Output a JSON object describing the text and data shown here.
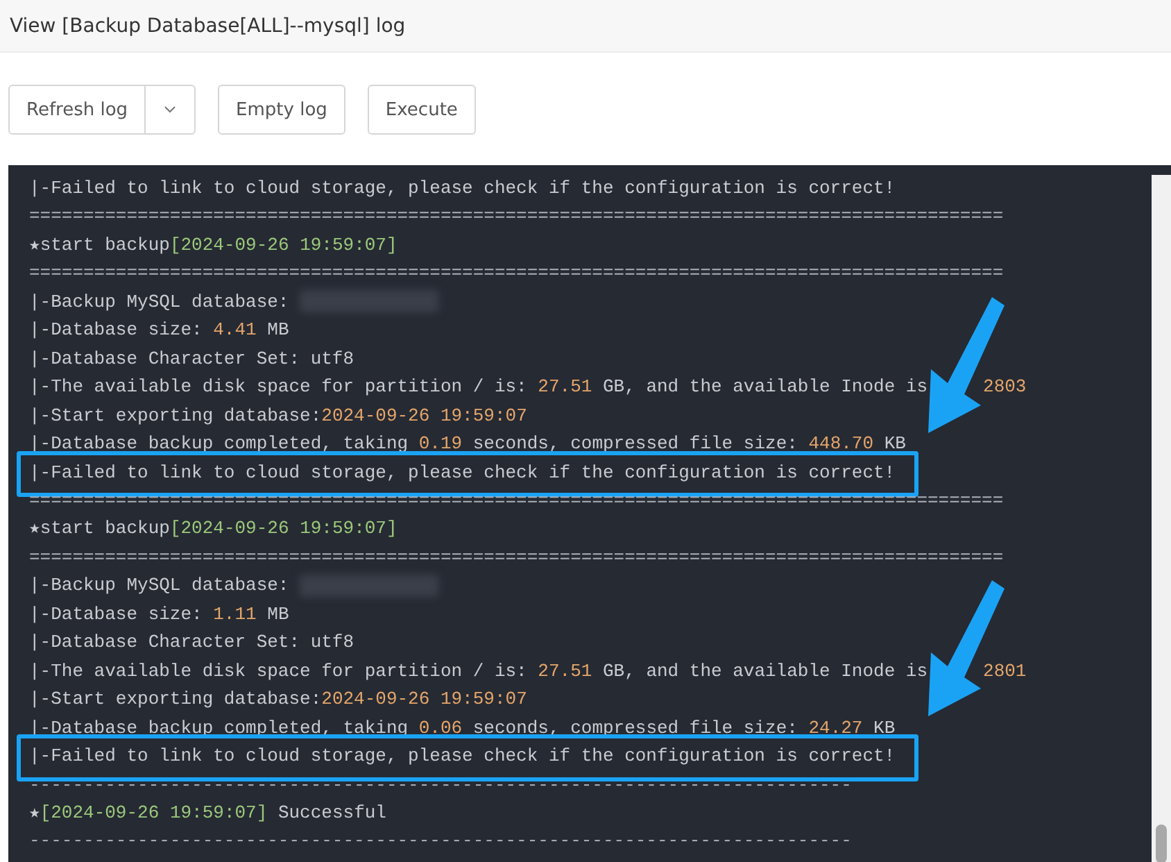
{
  "window": {
    "title": "View [Backup Database[ALL]--mysql] log"
  },
  "buttons": [
    {
      "kind": "split",
      "label": "Refresh log"
    },
    {
      "kind": "plain",
      "label": "Empty log"
    },
    {
      "kind": "plain",
      "label": "Execute"
    }
  ],
  "log": [
    {
      "highlighted": false,
      "segments": [
        {
          "kind": "plain",
          "text": "|-Failed to link to cloud storage, please check if the configuration is correct!"
        }
      ]
    },
    {
      "highlighted": false,
      "segments": [
        {
          "kind": "rule",
          "text": "=========================================================================================="
        }
      ]
    },
    {
      "highlighted": false,
      "segments": [
        {
          "kind": "plain",
          "text": "★start backup"
        },
        {
          "kind": "green",
          "text": "[2024-09-26 19:59:07]"
        }
      ]
    },
    {
      "highlighted": false,
      "segments": [
        {
          "kind": "rule",
          "text": "=========================================================================================="
        }
      ]
    },
    {
      "highlighted": false,
      "segments": [
        {
          "kind": "plain",
          "text": "|-Backup MySQL database: "
        },
        {
          "kind": "redacted"
        }
      ]
    },
    {
      "highlighted": false,
      "segments": [
        {
          "kind": "plain",
          "text": "|-Database size: "
        },
        {
          "kind": "orange",
          "text": "4.41"
        },
        {
          "kind": "plain",
          "text": " MB"
        }
      ]
    },
    {
      "highlighted": false,
      "segments": [
        {
          "kind": "plain",
          "text": "|-Database Character Set: utf8"
        }
      ]
    },
    {
      "highlighted": false,
      "segments": [
        {
          "kind": "plain",
          "text": "|-The available disk space for partition / is: "
        },
        {
          "kind": "orange",
          "text": "27.51"
        },
        {
          "kind": "plain",
          "text": " GB, and the available Inode is"
        },
        {
          "kind": "gap"
        },
        {
          "kind": "orange",
          "text": "2803"
        }
      ]
    },
    {
      "highlighted": false,
      "segments": [
        {
          "kind": "plain",
          "text": "|-Start exporting database:"
        },
        {
          "kind": "orange",
          "text": "2024-09-26 19:59:07"
        }
      ]
    },
    {
      "highlighted": false,
      "segments": [
        {
          "kind": "plain",
          "text": "|-Database backup completed, taking "
        },
        {
          "kind": "orange",
          "text": "0.19"
        },
        {
          "kind": "plain",
          "text": " seconds, compressed file size: "
        },
        {
          "kind": "orange",
          "text": "448.70"
        },
        {
          "kind": "plain",
          "text": " KB"
        }
      ]
    },
    {
      "highlighted": true,
      "segments": [
        {
          "kind": "plain",
          "text": "|-Failed to link to cloud storage, please check if the configuration is correct!"
        }
      ]
    },
    {
      "highlighted": false,
      "segments": [
        {
          "kind": "rule",
          "text": "=========================================================================================="
        }
      ]
    },
    {
      "highlighted": false,
      "segments": [
        {
          "kind": "plain",
          "text": "★start backup"
        },
        {
          "kind": "green",
          "text": "[2024-09-26 19:59:07]"
        }
      ]
    },
    {
      "highlighted": false,
      "segments": [
        {
          "kind": "rule",
          "text": "=========================================================================================="
        }
      ]
    },
    {
      "highlighted": false,
      "segments": [
        {
          "kind": "plain",
          "text": "|-Backup MySQL database: "
        },
        {
          "kind": "redacted"
        }
      ]
    },
    {
      "highlighted": false,
      "segments": [
        {
          "kind": "plain",
          "text": "|-Database size: "
        },
        {
          "kind": "orange",
          "text": "1.11"
        },
        {
          "kind": "plain",
          "text": " MB"
        }
      ]
    },
    {
      "highlighted": false,
      "segments": [
        {
          "kind": "plain",
          "text": "|-Database Character Set: utf8"
        }
      ]
    },
    {
      "highlighted": false,
      "segments": [
        {
          "kind": "plain",
          "text": "|-The available disk space for partition / is: "
        },
        {
          "kind": "orange",
          "text": "27.51"
        },
        {
          "kind": "plain",
          "text": " GB, and the available Inode is"
        },
        {
          "kind": "gap"
        },
        {
          "kind": "orange",
          "text": "2801"
        }
      ]
    },
    {
      "highlighted": false,
      "segments": [
        {
          "kind": "plain",
          "text": "|-Start exporting database:"
        },
        {
          "kind": "orange",
          "text": "2024-09-26 19:59:07"
        }
      ]
    },
    {
      "highlighted": false,
      "segments": [
        {
          "kind": "plain",
          "text": "|-Database backup completed, taking "
        },
        {
          "kind": "orange",
          "text": "0.06"
        },
        {
          "kind": "plain",
          "text": " seconds, compressed file size: "
        },
        {
          "kind": "orange",
          "text": "24.27"
        },
        {
          "kind": "plain",
          "text": " KB"
        }
      ]
    },
    {
      "highlighted": true,
      "segments": [
        {
          "kind": "plain",
          "text": "|-Failed to link to cloud storage, please check if the configuration is correct!"
        }
      ]
    },
    {
      "highlighted": false,
      "segments": [
        {
          "kind": "rule",
          "text": "----------------------------------------------------------------------------"
        }
      ]
    },
    {
      "highlighted": false,
      "segments": [
        {
          "kind": "plain",
          "text": "★"
        },
        {
          "kind": "green",
          "text": "[2024-09-26 19:59:07]"
        },
        {
          "kind": "plain",
          "text": " Successful"
        }
      ]
    },
    {
      "highlighted": false,
      "segments": [
        {
          "kind": "rule",
          "text": "----------------------------------------------------------------------------"
        }
      ]
    }
  ]
}
